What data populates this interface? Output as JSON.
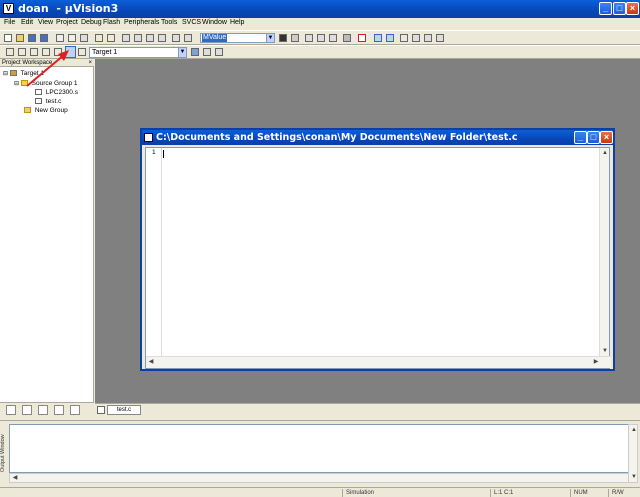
{
  "window": {
    "title": "doan  - µVision3",
    "icon_letter": "V",
    "controls": {
      "minimize": "_",
      "maximize": "□",
      "close": "×"
    }
  },
  "menu": [
    "File",
    "Edit",
    "View",
    "Project",
    "Debug",
    "Flash",
    "Peripherals",
    "Tools",
    "SVCS",
    "Window",
    "Help"
  ],
  "toolbar": {
    "find_value": "MValue",
    "target_value": "Target 1"
  },
  "workspace": {
    "title": "Project Workspace",
    "close": "×",
    "tree": {
      "root": "Target 1",
      "group": "Source Group 1",
      "files": [
        "LPC2300.s",
        "test.c"
      ],
      "new_group": "New Group"
    }
  },
  "editor": {
    "title": "C:\\Documents and Settings\\conan\\My Documents\\New Folder\\test.c",
    "line_number": "1",
    "tab_label": "test.c"
  },
  "output": {
    "label": "Output Window"
  },
  "statusbar": {
    "mode": "Simulation",
    "position": "L:1 C:1",
    "num": "NUM",
    "rw": "R/W"
  },
  "annotation": {
    "arrow_color": "#e02020"
  }
}
